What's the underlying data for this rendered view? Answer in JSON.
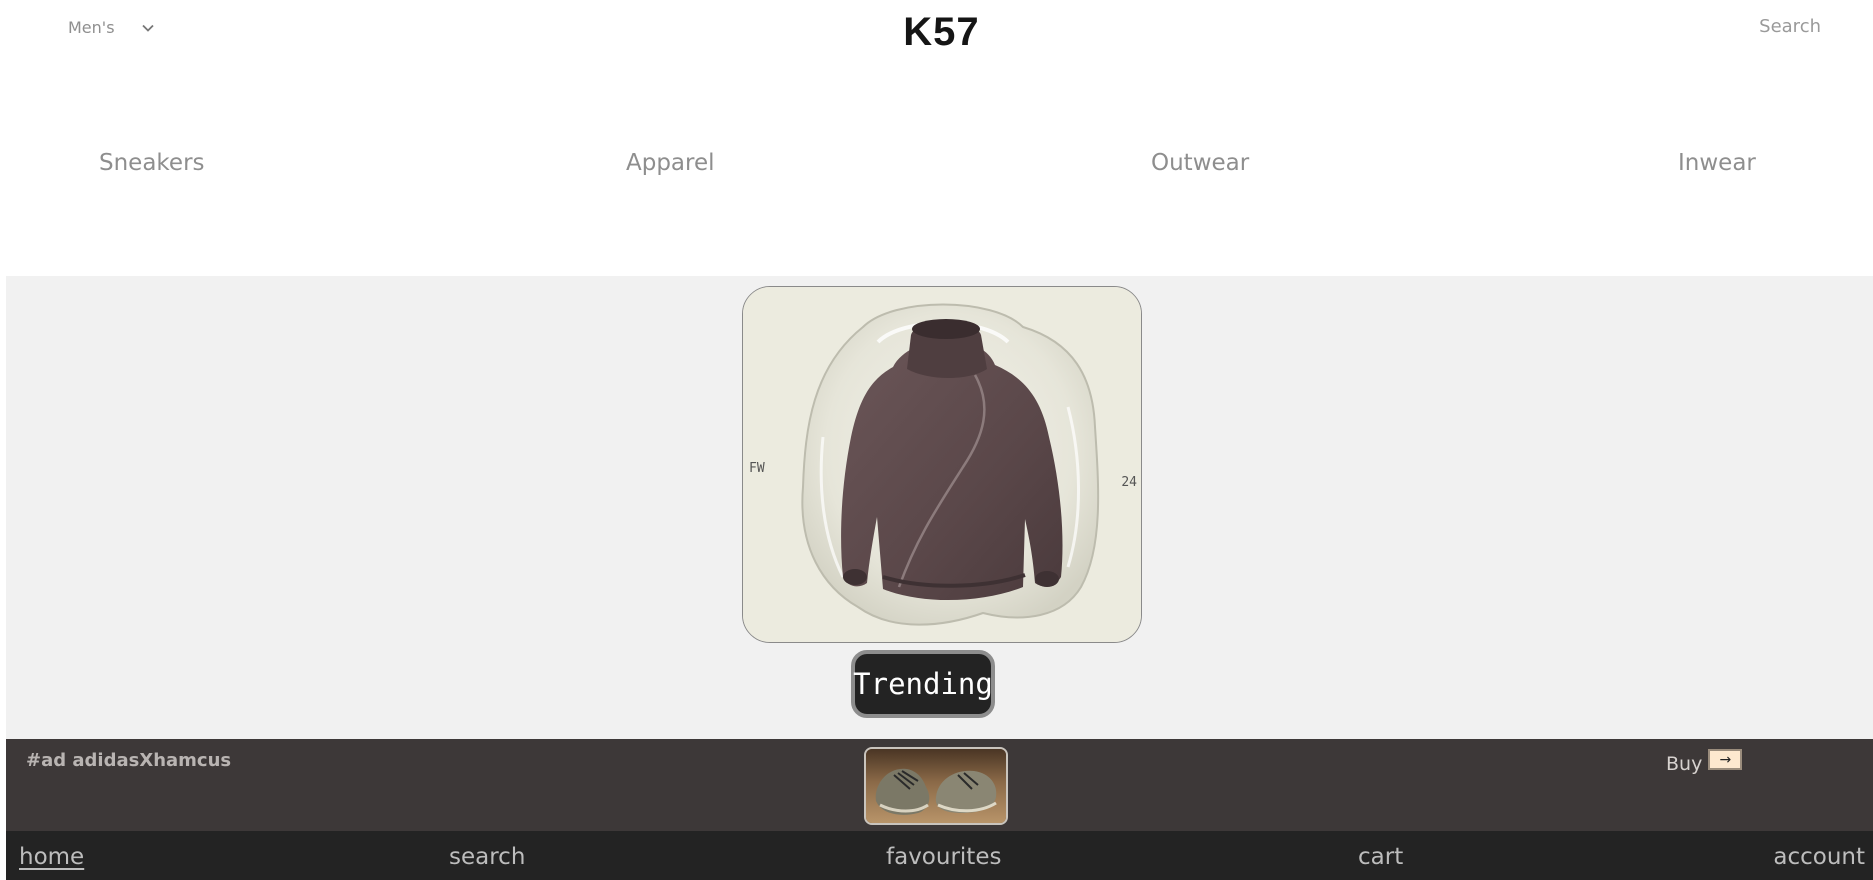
{
  "header": {
    "gender_selected": "Men's",
    "logo": "K57",
    "search_label": "Search"
  },
  "categories": [
    {
      "label": "Sneakers"
    },
    {
      "label": "Apparel"
    },
    {
      "label": "Outwear"
    },
    {
      "label": "Inwear"
    }
  ],
  "hero": {
    "season_left": "FW",
    "season_right": "24",
    "product_image": "brown-turtleneck-fleece-jacket",
    "trending_label": "Trending"
  },
  "ad": {
    "text": "#ad adidasXhamcus",
    "thumbnail": "sneakers-pair-on-sand",
    "buy_label": "Buy",
    "buy_icon": "→"
  },
  "tabbar": {
    "items": [
      {
        "label": "home",
        "active": true
      },
      {
        "label": "search",
        "active": false
      },
      {
        "label": "favourites",
        "active": false
      },
      {
        "label": "cart",
        "active": false
      },
      {
        "label": "account",
        "active": false
      }
    ]
  },
  "colors": {
    "hero_bg": "#f1f1f1",
    "ad_strip_bg": "#3d3838",
    "tabbar_bg": "#232323",
    "trending_bg": "#232323",
    "buy_arrow_bg": "#fde8cf"
  }
}
